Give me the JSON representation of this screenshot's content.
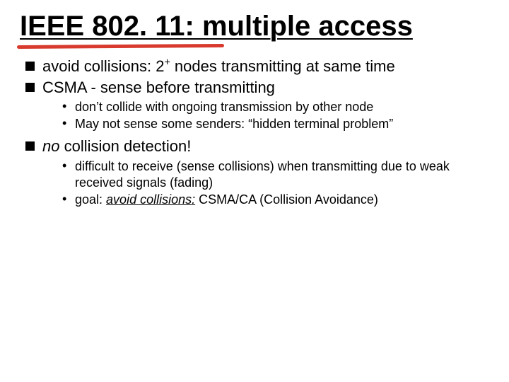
{
  "title": "IEEE 802. 11: multiple access",
  "bullets": {
    "b1_pre": "avoid collisions: 2",
    "b1_sup": "+",
    "b1_post": " nodes transmitting at same time",
    "b2": "CSMA - sense before transmitting",
    "b2_sub1": "don’t collide with ongoing transmission by other node",
    "b2_sub2": "May not sense some senders: “hidden terminal problem”",
    "b3_em": "no",
    "b3_rest": " collision detection!",
    "b3_sub1": "difficult to receive (sense collisions) when transmitting due to weak received signals (fading)",
    "b3_sub2_pre": "goal: ",
    "b3_sub2_em": "avoid collisions:",
    "b3_sub2_post": " CSMA/CA (Collision Avoidance)"
  }
}
